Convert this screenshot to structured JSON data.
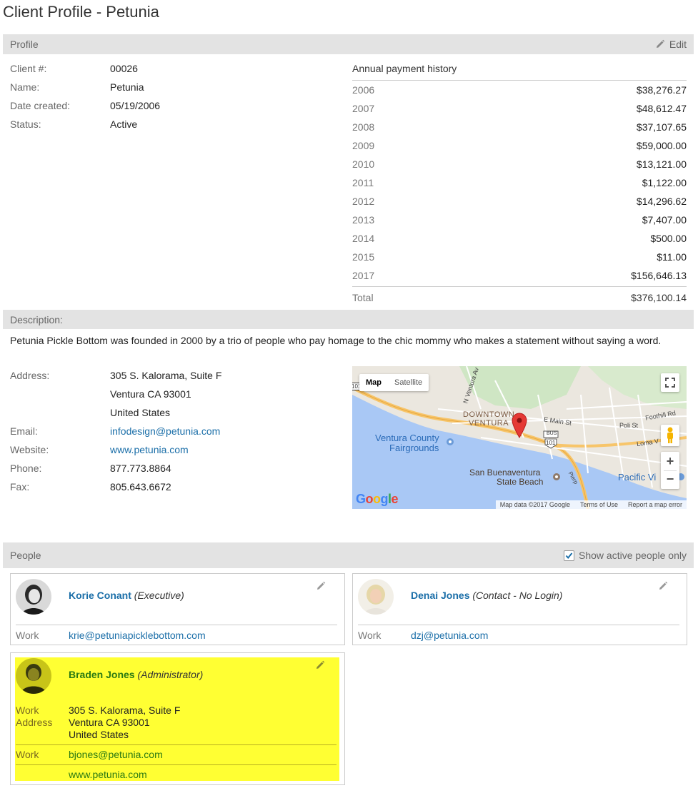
{
  "page": {
    "title": "Client Profile - Petunia"
  },
  "profile": {
    "section_label": "Profile",
    "edit_label": "Edit",
    "client_num_label": "Client #:",
    "client_num": "00026",
    "name_label": "Name:",
    "name": "Petunia",
    "date_created_label": "Date created:",
    "date_created": "05/19/2006",
    "status_label": "Status:",
    "status": "Active"
  },
  "payments": {
    "heading": "Annual payment history",
    "rows": [
      {
        "year": "2006",
        "amount": "$38,276.27"
      },
      {
        "year": "2007",
        "amount": "$48,612.47"
      },
      {
        "year": "2008",
        "amount": "$37,107.65"
      },
      {
        "year": "2009",
        "amount": "$59,000.00"
      },
      {
        "year": "2010",
        "amount": "$13,121.00"
      },
      {
        "year": "2011",
        "amount": "$1,122.00"
      },
      {
        "year": "2012",
        "amount": "$14,296.62"
      },
      {
        "year": "2013",
        "amount": "$7,407.00"
      },
      {
        "year": "2014",
        "amount": "$500.00"
      },
      {
        "year": "2015",
        "amount": "$11.00"
      },
      {
        "year": "2017",
        "amount": "$156,646.13"
      }
    ],
    "total_label": "Total",
    "total": "$376,100.14"
  },
  "description": {
    "section_label": "Description:",
    "text": "Petunia Pickle Bottom was founded in 2000 by a trio of people who pay homage to the chic mommy who makes a statement without saying a word.",
    "address_label": "Address:",
    "address_line1": "305 S. Kalorama, Suite F",
    "address_line2": "Ventura CA 93001",
    "address_line3": "United States",
    "email_label": "Email:",
    "email": "infodesign@petunia.com",
    "website_label": "Website:",
    "website": "www.petunia.com",
    "phone_label": "Phone:",
    "phone": "877.773.8864",
    "fax_label": "Fax:",
    "fax": "805.643.6672"
  },
  "map": {
    "type_map": "Map",
    "type_satellite": "Satellite",
    "label_downtown": "DOWNTOWN",
    "label_ventura": "VENTURA",
    "label_fairgrounds1": "Ventura County",
    "label_fairgrounds2": "Fairgrounds",
    "label_beach1": "San Buenaventura",
    "label_beach2": "State Beach",
    "label_main": "E Main St",
    "label_poli": "Poli St",
    "label_foothill": "Foothill Rd",
    "label_loma": "Loma V",
    "label_pacific": "Pacific Vi",
    "label_nventura": "N Ventura Av",
    "label_pierpont": "Pierp",
    "label_101": "101",
    "label_bus": "BUS",
    "label_101b": "101",
    "google": "Google",
    "footer_data": "Map data ©2017 Google",
    "footer_terms": "Terms of Use",
    "footer_report": "Report a map error",
    "zoom_in": "+",
    "zoom_out": "−"
  },
  "people": {
    "section_label": "People",
    "filter_label": "Show active people only",
    "cards": [
      {
        "name": "Korie Conant",
        "role": "(Executive)",
        "work_label": "Work",
        "email": "krie@petuniapicklebottom.com"
      },
      {
        "name": "Denai Jones",
        "role": "(Contact - No Login)",
        "work_label": "Work",
        "email": "dzj@petunia.com"
      },
      {
        "name": "Braden Jones",
        "role": "(Administrator)",
        "address_label_1": "Work",
        "address_label_2": "Address",
        "address_line1": "305 S. Kalorama, Suite F",
        "address_line2": "Ventura CA 93001",
        "address_line3": "United States",
        "work_label": "Work",
        "email": "bjones@petunia.com",
        "website": "www.petunia.com"
      }
    ]
  },
  "colors": {
    "accent_link": "#1a6ea8",
    "highlight": "#ffff33",
    "section_bg": "#e3e3e3"
  }
}
